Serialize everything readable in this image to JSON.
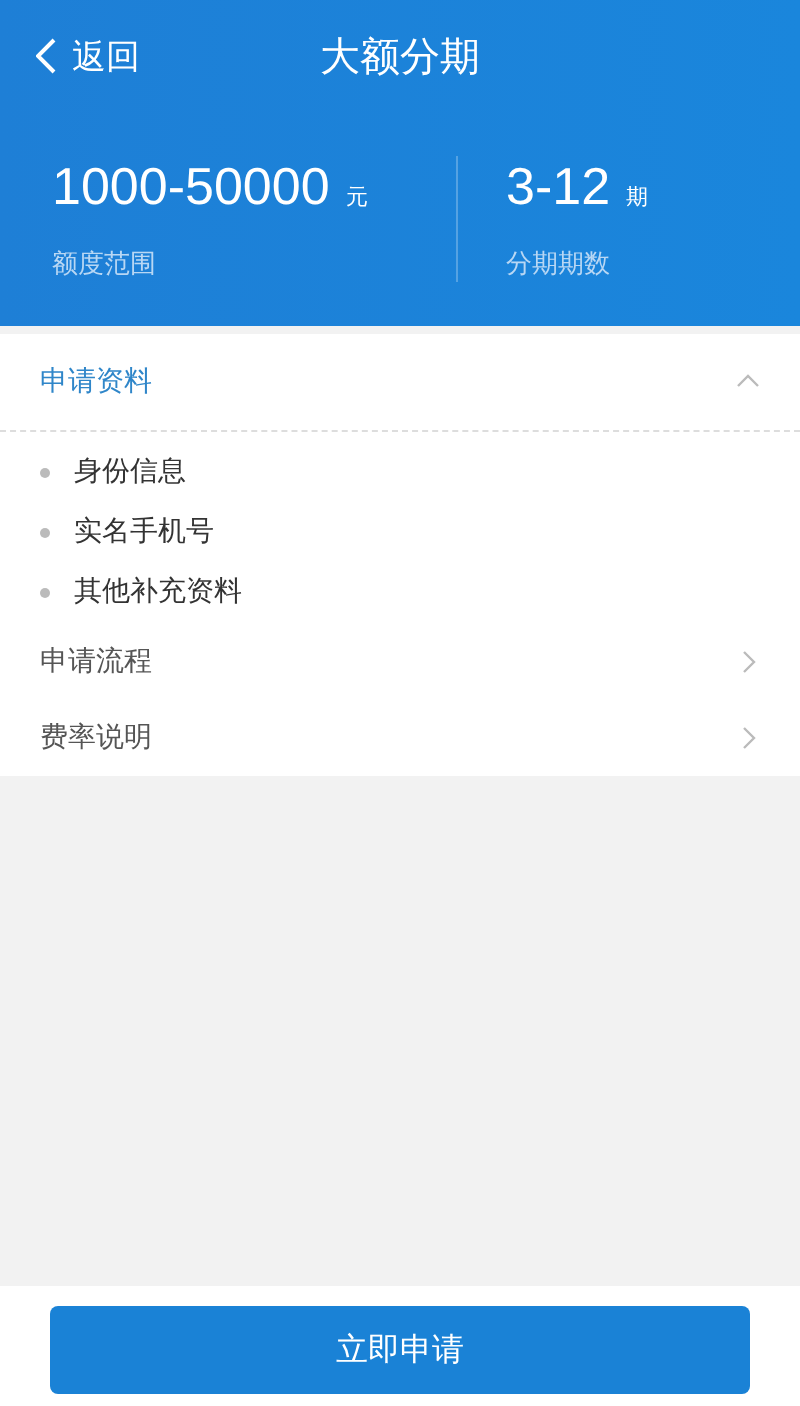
{
  "nav": {
    "back": "返回",
    "title": "大额分期"
  },
  "stats": [
    {
      "value": "1000-50000",
      "unit": "元",
      "label": "额度范围"
    },
    {
      "value": "3-12",
      "unit": "期",
      "label": "分期期数"
    }
  ],
  "sections": [
    {
      "title": "申请资料",
      "expanded": true,
      "items": [
        "身份信息",
        "实名手机号",
        "其他补充资料"
      ]
    },
    {
      "title": "申请流程",
      "expanded": false
    },
    {
      "title": "费率说明",
      "expanded": false
    }
  ],
  "apply_button": "立即申请"
}
